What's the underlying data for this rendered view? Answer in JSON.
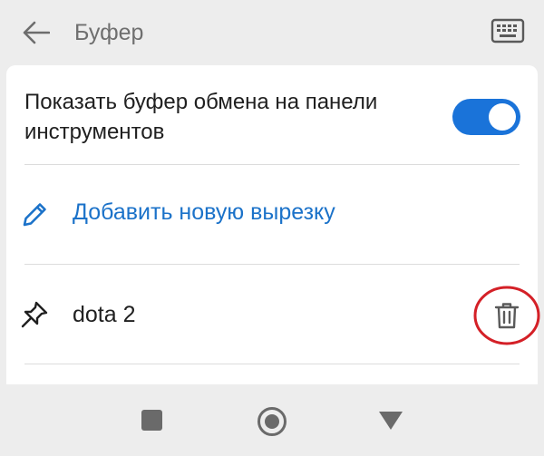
{
  "header": {
    "title": "Буфер",
    "back_icon": "arrow-left-icon",
    "keyboard_icon": "keyboard-icon"
  },
  "settings": {
    "show_toolbar_label": "Показать буфер обмена на панели инструментов",
    "show_toolbar_enabled": true,
    "add_clip_label": "Добавить новую вырезку",
    "add_clip_icon": "pencil-icon"
  },
  "clips": [
    {
      "text": "dota 2",
      "pin_icon": "pin-icon",
      "delete_icon": "trash-icon"
    }
  ],
  "colors": {
    "accent": "#1a73d9",
    "link": "#1b72c9",
    "annotation": "#d42027"
  },
  "navigation": {
    "recent_icon": "square-icon",
    "home_icon": "circle-icon",
    "back_icon": "triangle-down-icon"
  }
}
